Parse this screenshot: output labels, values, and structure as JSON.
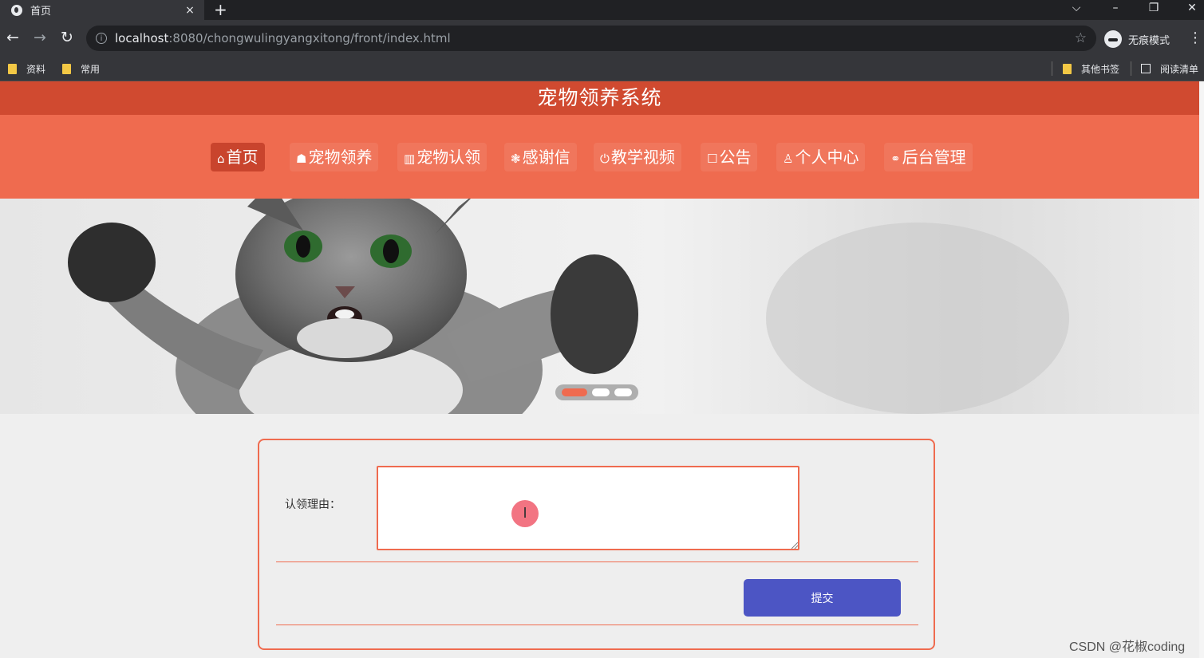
{
  "browser": {
    "tab_title": "首页",
    "tab_close": "×",
    "new_tab": "+",
    "url_host": "localhost",
    "url_rest": ":8080/chongwulingyangxitong/front/index.html",
    "incognito_label": "无痕模式",
    "bookmarks": [
      "资料",
      "常用"
    ],
    "other_bookmarks": "其他书签",
    "reading_list": "阅读清单"
  },
  "site": {
    "title": "宠物领养系统",
    "nav": [
      {
        "icon": "⌂",
        "label": "首页"
      },
      {
        "icon": "☗",
        "label": "宠物领养"
      },
      {
        "icon": "▥",
        "label": "宠物认领"
      },
      {
        "icon": "❃",
        "label": "感谢信"
      },
      {
        "icon": "⏻",
        "label": "教学视频"
      },
      {
        "icon": "☐",
        "label": "公告"
      },
      {
        "icon": "♙",
        "label": "个人中心"
      },
      {
        "icon": "⚭",
        "label": "后台管理"
      }
    ],
    "active_nav": "首页",
    "carousel_slides": 3,
    "carousel_active": 1
  },
  "form": {
    "reason_label": "认领理由：",
    "reason_value": "",
    "submit_label": "提交"
  },
  "watermark": "CSDN @花椒coding",
  "colors": {
    "header": "#d04a30",
    "nav": "#ef6b4f",
    "accent": "#ef6b4f",
    "submit": "#4c55c4"
  }
}
